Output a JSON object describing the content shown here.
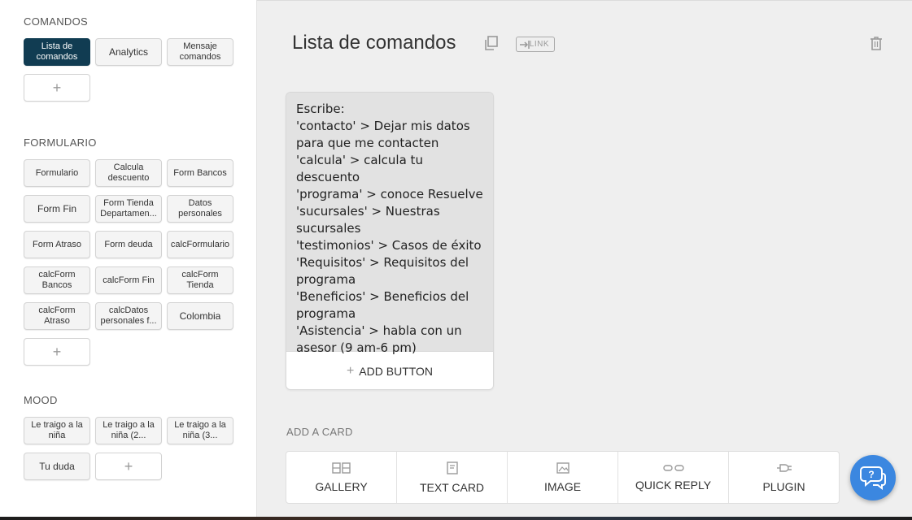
{
  "sidebar": {
    "sections": [
      {
        "title": "COMANDOS",
        "blocks": [
          "Lista de comandos",
          "Analytics",
          "Mensaje comandos"
        ],
        "add_label": "+"
      },
      {
        "title": "FORMULARIO",
        "blocks": [
          "Formulario",
          "Calcula descuento",
          "Form Bancos",
          "Form Fin",
          "Form Tienda Departamen...",
          "Datos personales",
          "Form Atraso",
          "Form deuda",
          "calcFormulario",
          "calcForm Bancos",
          "calcForm Fin",
          "calcForm Tienda",
          "calcForm Atraso",
          "calcDatos personales f...",
          "Colombia"
        ],
        "add_label": "+"
      },
      {
        "title": "MOOD",
        "blocks": [
          "Le traigo a la niña",
          "Le traigo a la niña (2...",
          "Le traigo a la niña (3...",
          "Tu duda"
        ],
        "add_label": "+"
      }
    ]
  },
  "main": {
    "title": "Lista de comandos",
    "link_label": "LINK",
    "card_text": "Escribe:\n'contacto' > Dejar mis datos para que me contacten\n'calcula' > calcula tu descuento\n'programa' > conoce Resuelve\n'sucursales' > Nuestras sucursales\n'testimonios' > Casos de éxito\n'Requisitos' > Requisitos del programa\n'Beneficios' > Beneficios del programa\n'Asistencia' > habla con un asesor (9 am-6 pm)",
    "add_button_label": "ADD BUTTON",
    "add_card_label": "ADD A CARD",
    "card_types": [
      "GALLERY",
      "TEXT CARD",
      "IMAGE",
      "QUICK REPLY",
      "PLUGIN"
    ]
  },
  "colors": {
    "active_block": "#113c52",
    "fab": "#3b87e0"
  }
}
